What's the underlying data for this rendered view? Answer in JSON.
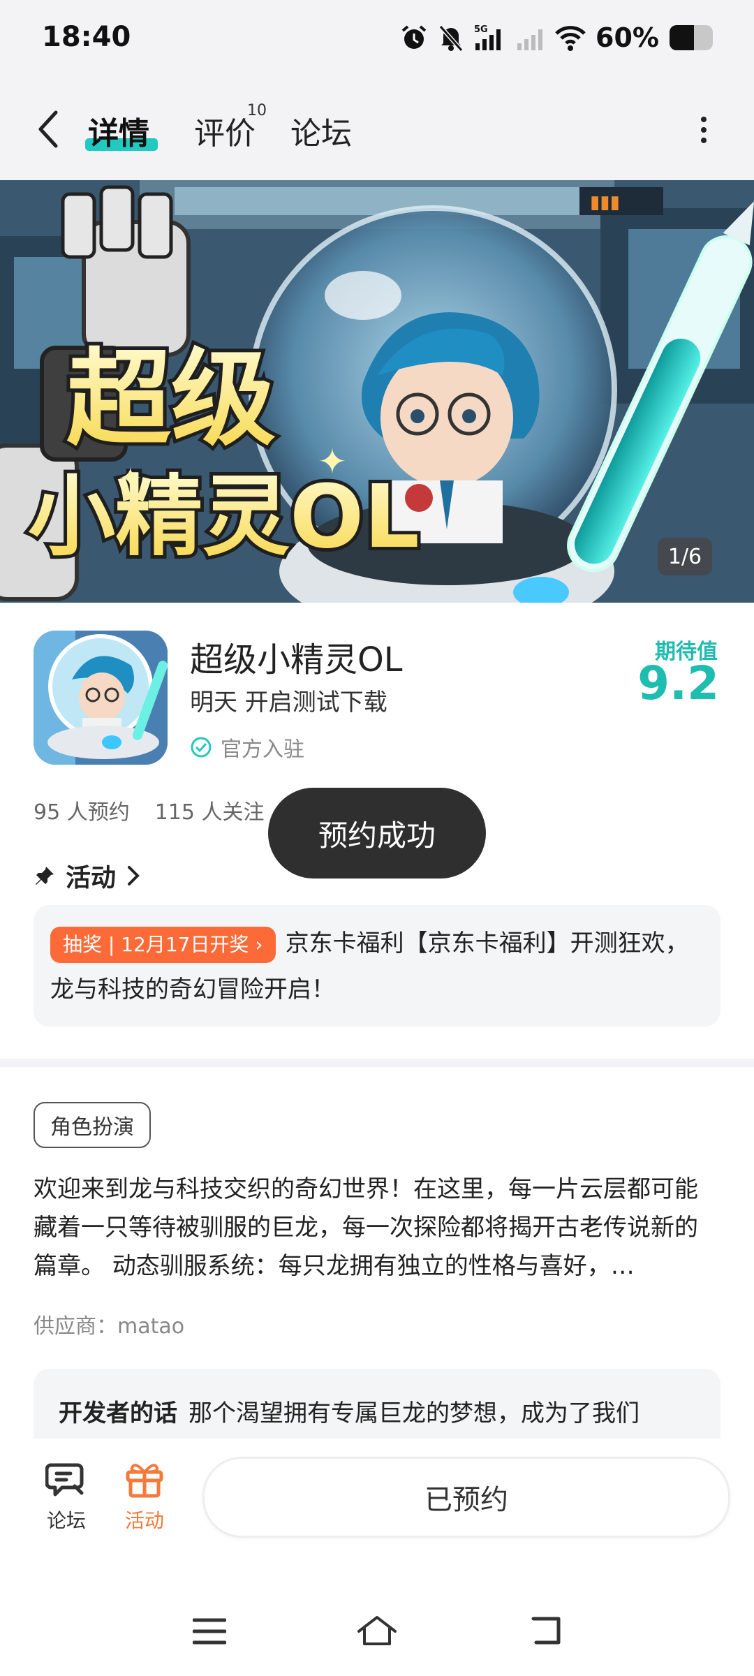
{
  "status_bar": {
    "time": "18:40",
    "network": "5G",
    "battery": "60%",
    "icons": [
      "alarm-icon",
      "mute-bell-icon",
      "signal-5g-icon",
      "signal-empty-icon",
      "wifi-icon",
      "battery-icon"
    ]
  },
  "nav": {
    "tabs": [
      {
        "label": "详情",
        "active": true
      },
      {
        "label": "评价",
        "count": "10"
      },
      {
        "label": "论坛"
      }
    ]
  },
  "hero": {
    "logo_line1": "超级",
    "logo_line2": "小精灵OL",
    "pager": "1/6"
  },
  "app": {
    "name": "超级小精灵OL",
    "subtitle": "明天 开启测试下载",
    "official": "官方入驻",
    "score_label": "期待值",
    "score": "9.2",
    "reservations": "95 人预约",
    "followers": "115 人关注"
  },
  "toast": "预约成功",
  "activity": {
    "header": "活动",
    "badge": "抽奖 | 12月17日开奖 ›",
    "text": "京东卡福利【京东卡福利】开测狂欢，龙与科技的奇幻冒险开启！"
  },
  "detail": {
    "genre_tag": "角色扮演",
    "description": "欢迎来到龙与科技交织的奇幻世界！在这里，每一片云层都可能藏着一只等待被驯服的巨龙，每一次探险都将揭开古老传说新的篇章。 动态驯服系统：每只龙拥有独立的性格与喜好，…",
    "supplier": "供应商：matao",
    "dev_label": "开发者的话",
    "dev_text": "那个渴望拥有专属巨龙的梦想，成为了我们"
  },
  "bottom_bar": {
    "forum_label": "论坛",
    "activity_label": "活动",
    "reserved_button": "已预约"
  },
  "colors": {
    "accent": "#21c9c0",
    "score": "#1fbcb0",
    "badge": "#fb6a37",
    "activity_orange": "#f27a3a"
  }
}
